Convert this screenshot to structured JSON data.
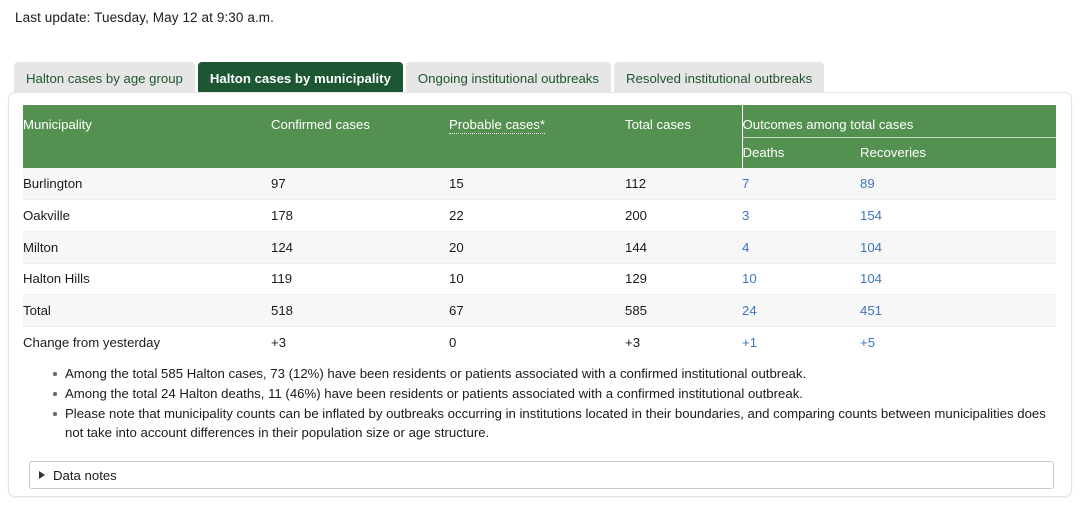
{
  "last_update": "Last update: Tuesday, May 12 at 9:30 a.m.",
  "tabs": [
    {
      "label": "Halton cases by age group",
      "active": false
    },
    {
      "label": "Halton cases by municipality",
      "active": true
    },
    {
      "label": "Ongoing institutional outbreaks",
      "active": false
    },
    {
      "label": "Resolved institutional outbreaks",
      "active": false
    }
  ],
  "table": {
    "headers": {
      "municipality": "Municipality",
      "confirmed": "Confirmed cases",
      "probable": "Probable cases*",
      "total": "Total cases",
      "outcomes_group": "Outcomes among total cases",
      "deaths": "Deaths",
      "recoveries": "Recoveries"
    },
    "rows": [
      {
        "municipality": "Burlington",
        "confirmed": "97",
        "probable": "15",
        "total": "112",
        "deaths": "7",
        "recoveries": "89"
      },
      {
        "municipality": "Oakville",
        "confirmed": "178",
        "probable": "22",
        "total": "200",
        "deaths": "3",
        "recoveries": "154"
      },
      {
        "municipality": "Milton",
        "confirmed": "124",
        "probable": "20",
        "total": "144",
        "deaths": "4",
        "recoveries": "104"
      },
      {
        "municipality": "Halton Hills",
        "confirmed": "119",
        "probable": "10",
        "total": "129",
        "deaths": "10",
        "recoveries": "104"
      },
      {
        "municipality": "Total",
        "confirmed": "518",
        "probable": "67",
        "total": "585",
        "deaths": "24",
        "recoveries": "451"
      },
      {
        "municipality": "Change from yesterday",
        "confirmed": "+3",
        "probable": "0",
        "total": "+3",
        "deaths": "+1",
        "recoveries": "+5"
      }
    ]
  },
  "notes": [
    "Among the total 585 Halton cases, 73 (12%) have been residents or patients associated with a confirmed institutional outbreak.",
    "Among the total 24 Halton deaths, 11 (46%) have been residents or patients associated with a confirmed institutional outbreak.",
    "Please note that municipality counts can be inflated by outbreaks occurring in institutions located in their boundaries, and comparing counts between municipalities does not take into account differences in their population size or age structure."
  ],
  "data_notes": {
    "label": "Data notes"
  },
  "colors": {
    "header_green": "#549150",
    "tab_active_green": "#1d5632",
    "tab_inactive_bg": "#e6e6e6",
    "link_blue": "#3f76bd",
    "row_stripe": "#f7f7f7"
  }
}
